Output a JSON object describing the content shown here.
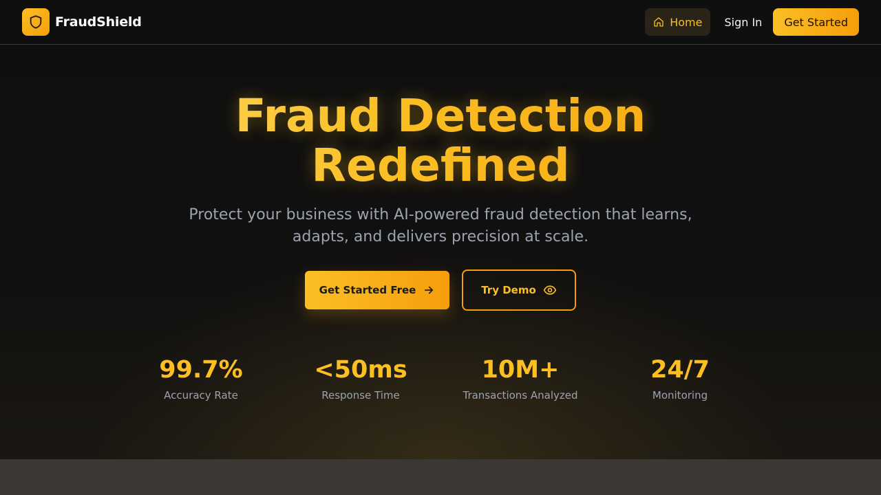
{
  "header": {
    "brand_name": "FraudShield",
    "brand_icon": "shield-icon",
    "nav_home_label": "Home",
    "nav_home_icon": "home-icon",
    "nav_signin_label": "Sign In",
    "nav_cta_label": "Get Started"
  },
  "hero": {
    "headline_line1": "Fraud Detection",
    "headline_line2": "Redefined",
    "subheadline": "Protect your business with AI-powered fraud detection that learns, adapts, and delivers precision at scale.",
    "primary_cta_label": "Get Started Free",
    "primary_cta_icon": "arrow-right-icon",
    "secondary_cta_label": "Try Demo",
    "secondary_cta_icon": "eye-icon"
  },
  "stats": [
    {
      "value": "99.7%",
      "label": "Accuracy Rate"
    },
    {
      "value": "<50ms",
      "label": "Response Time"
    },
    {
      "value": "10M+",
      "label": "Transactions Analyzed"
    },
    {
      "value": "24/7",
      "label": "Monitoring"
    }
  ],
  "colors": {
    "accent": "#fbbf24",
    "accent_dark": "#f59e0b",
    "background": "#0e0e0e",
    "muted_text": "#9ca3af"
  }
}
